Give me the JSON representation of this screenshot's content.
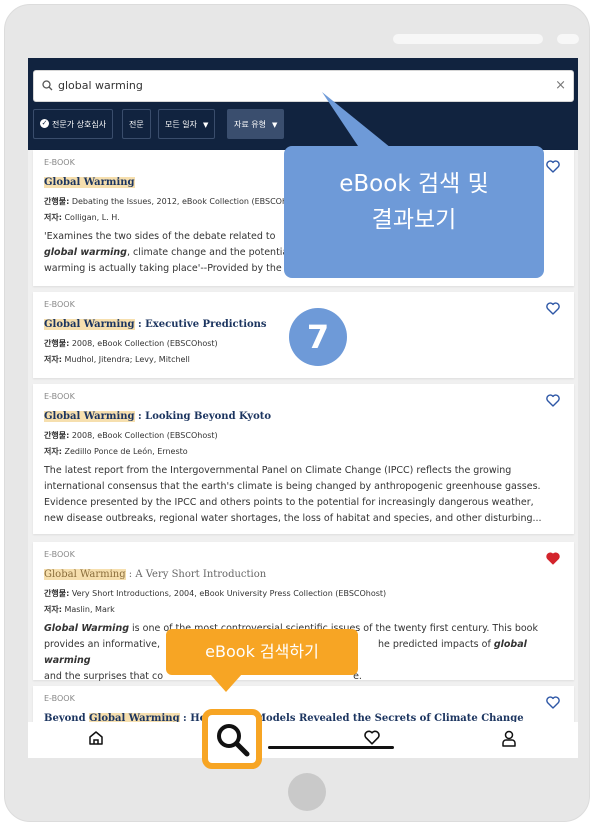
{
  "search": {
    "value": "global warming",
    "clear_icon": "close-icon"
  },
  "filters": [
    {
      "label": "전문가 상호심사",
      "icon": "check-circle-icon"
    },
    {
      "label": "전문"
    },
    {
      "label": "모든 일자",
      "dropdown": true
    },
    {
      "label": "자료 유형",
      "dropdown": true,
      "selected": true
    }
  ],
  "results": [
    {
      "type": "E-BOOK",
      "title_highlight": "Global Warming",
      "title_rest": "",
      "meta1_label": "간행물:",
      "meta1": " Debating the Issues, 2012, eBook Collection (EBSCOhost)",
      "meta2_label": "저자:",
      "meta2": " Colligan, L. H.",
      "abstract_a": "'Examines the two sides of the debate related to",
      "abstract_b_em": "global warming",
      "abstract_b": ", climate change and the potential",
      "abstract_c": "warming is actually taking place'--Provided by the",
      "favorite": false
    },
    {
      "type": "E-BOOK",
      "title_highlight": "Global Warming",
      "title_rest": " : Executive Predictions",
      "meta1_label": "간행물:",
      "meta1": " 2008, eBook Collection (EBSCOhost)",
      "meta2_label": "저자:",
      "meta2": " Mudhol, Jitendra; Levy, Mitchell",
      "favorite": false
    },
    {
      "type": "E-BOOK",
      "title_highlight": "Global Warming",
      "title_rest": " : Looking Beyond Kyoto",
      "meta1_label": "간행물:",
      "meta1": " 2008, eBook Collection (EBSCOhost)",
      "meta2_label": "저자:",
      "meta2": " Zedillo Ponce de León, Ernesto",
      "abstract_lines": [
        "The latest report from the Intergovernmental Panel on Climate Change (IPCC) reflects the growing",
        "international consensus that the earth's climate is being changed by anthropogenic greenhouse gasses.",
        "Evidence presented by the IPCC and others points to the potential for increasingly dangerous weather,",
        "new disease outbreaks, regional water shortages, the loss of habitat and species, and other disturbing..."
      ],
      "favorite": false
    },
    {
      "type": "E-BOOK",
      "title_highlight": "Global Warming",
      "title_rest": " : A Very Short Introduction",
      "meta1_label": "간행물:",
      "meta1": " Very Short Introductions, 2004, eBook University Press Collection (EBSCOhost)",
      "meta2_label": "저자:",
      "meta2": " Maslin, Mark",
      "abstract_a_em": "Global Warming",
      "abstract_a": " is one of the most controversial scientific issues of the twenty first century. This book",
      "abstract_b": "provides an informative,",
      "abstract_b2": "he predicted impacts of",
      "abstract_b_em": "global warming",
      "abstract_c": "and the surprises that co",
      "abstract_c2": "e.",
      "favorite": true
    },
    {
      "type": "E-BOOK",
      "title_pre": "Beyond ",
      "title_highlight": "Global Warming",
      "title_rest": " : How",
      "title_tail": "Models Revealed the Secrets of Climate Change",
      "favorite": false
    }
  ],
  "bottom_nav": [
    "home-icon",
    "search-icon",
    "heart-icon",
    "user-icon"
  ],
  "annotations": {
    "callout_top_line1": "eBook 검색 및",
    "callout_top_line2": "결과보기",
    "step_number": "7",
    "callout_bottom": "eBook 검색하기"
  },
  "colors": {
    "header": "#11233f",
    "highlight": "#f6dfae",
    "callout_blue": "#6e9ad8",
    "callout_orange": "#f7a524",
    "heart_active": "#d3242c"
  }
}
